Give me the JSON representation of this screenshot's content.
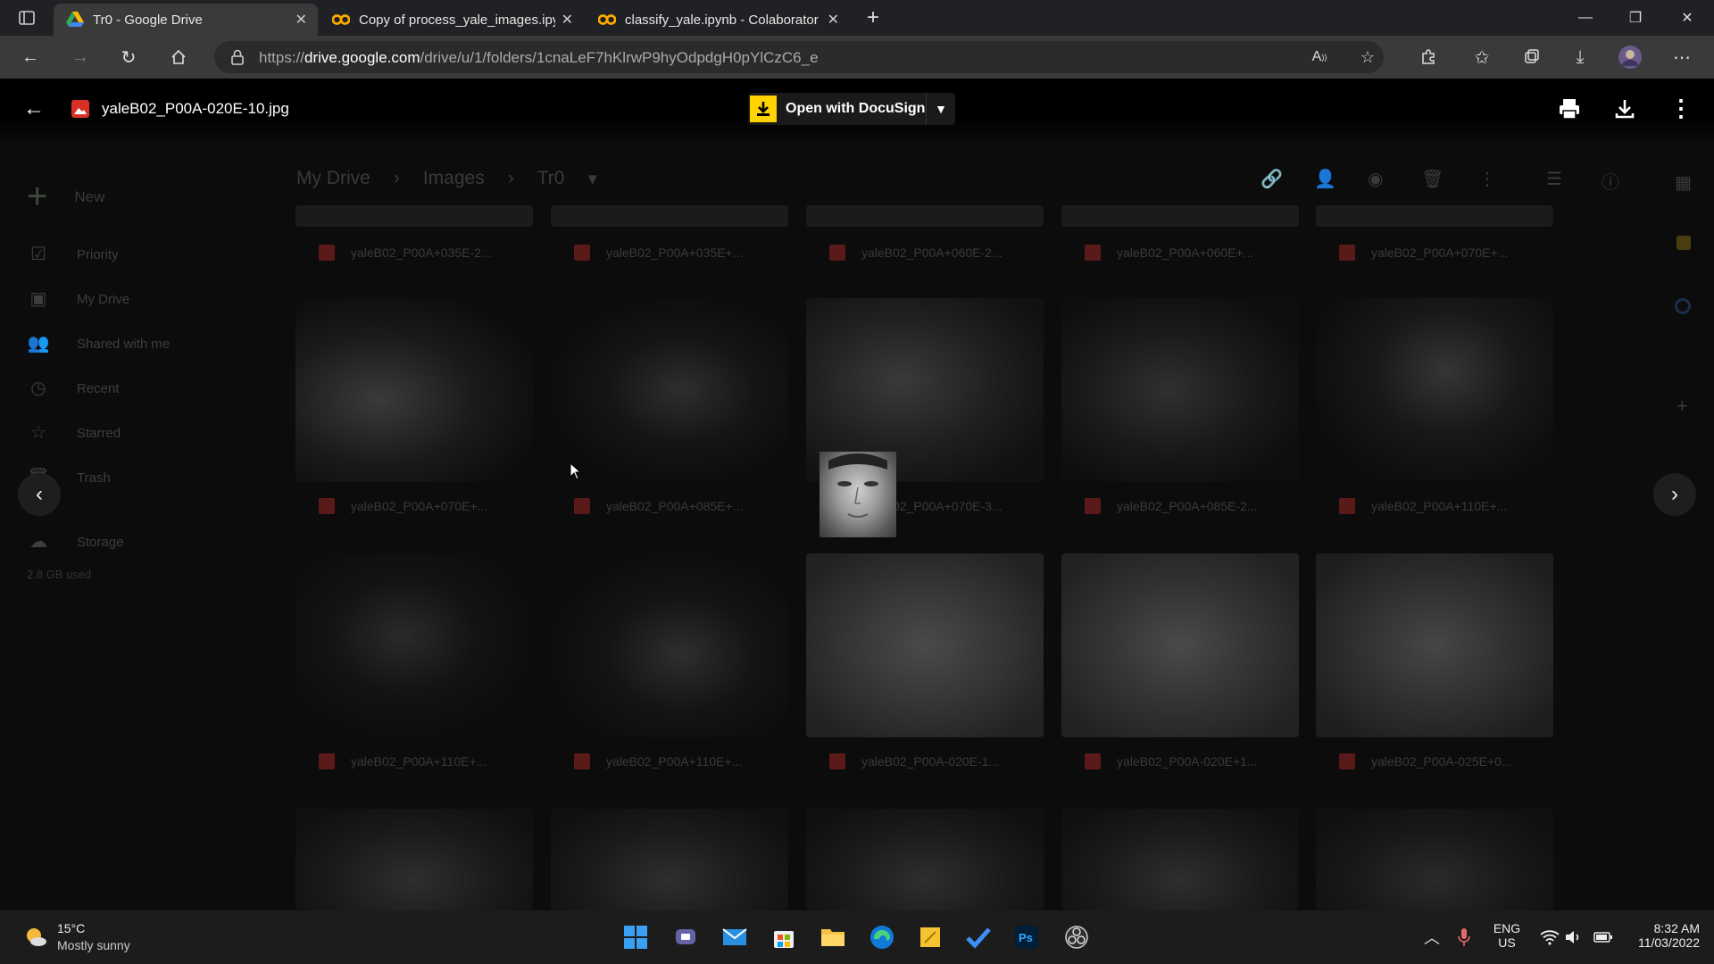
{
  "browser": {
    "tabs": [
      {
        "title": "Tr0 - Google Drive",
        "active": true
      },
      {
        "title": "Copy of process_yale_images.ipy",
        "active": false
      },
      {
        "title": "classify_yale.ipynb - Colaborator",
        "active": false
      }
    ],
    "url_prefix": "https://",
    "url_domain": "drive.google.com",
    "url_path": "/drive/u/1/folders/1cnaLeF7hKlrwP9hyOdpdgH0pYlCzC6_e"
  },
  "viewer": {
    "file_name": "yaleB02_P00A-020E-10.jpg",
    "open_with_label": "Open with DocuSign"
  },
  "drive": {
    "new_label": "New",
    "sidebar": [
      "Priority",
      "My Drive",
      "Shared with me",
      "Recent",
      "Starred",
      "Trash",
      "Storage"
    ],
    "storage_used": "2.8 GB used",
    "breadcrumb": [
      "My Drive",
      "Images",
      "Tr0"
    ],
    "row0_captions": [
      "yaleB02_P00A+035E-2...",
      "yaleB02_P00A+035E+...",
      "yaleB02_P00A+060E-2...",
      "yaleB02_P00A+060E+...",
      "yaleB02_P00A+070E+..."
    ],
    "row1_captions": [
      "yaleB02_P00A+070E+...",
      "yaleB02_P00A+085E+...",
      "yaleB02_P00A+070E-3...",
      "yaleB02_P00A+085E-2...",
      "yaleB02_P00A+110E+..."
    ],
    "row2_captions": [
      "yaleB02_P00A+110E+...",
      "yaleB02_P00A+110E+...",
      "yaleB02_P00A-020E-1...",
      "yaleB02_P00A-020E+1...",
      "yaleB02_P00A-025E+0..."
    ]
  },
  "taskbar": {
    "temperature": "15°C",
    "weather": "Mostly sunny",
    "lang1": "ENG",
    "lang2": "US",
    "time": "8:32 AM",
    "date": "11/03/2022"
  }
}
